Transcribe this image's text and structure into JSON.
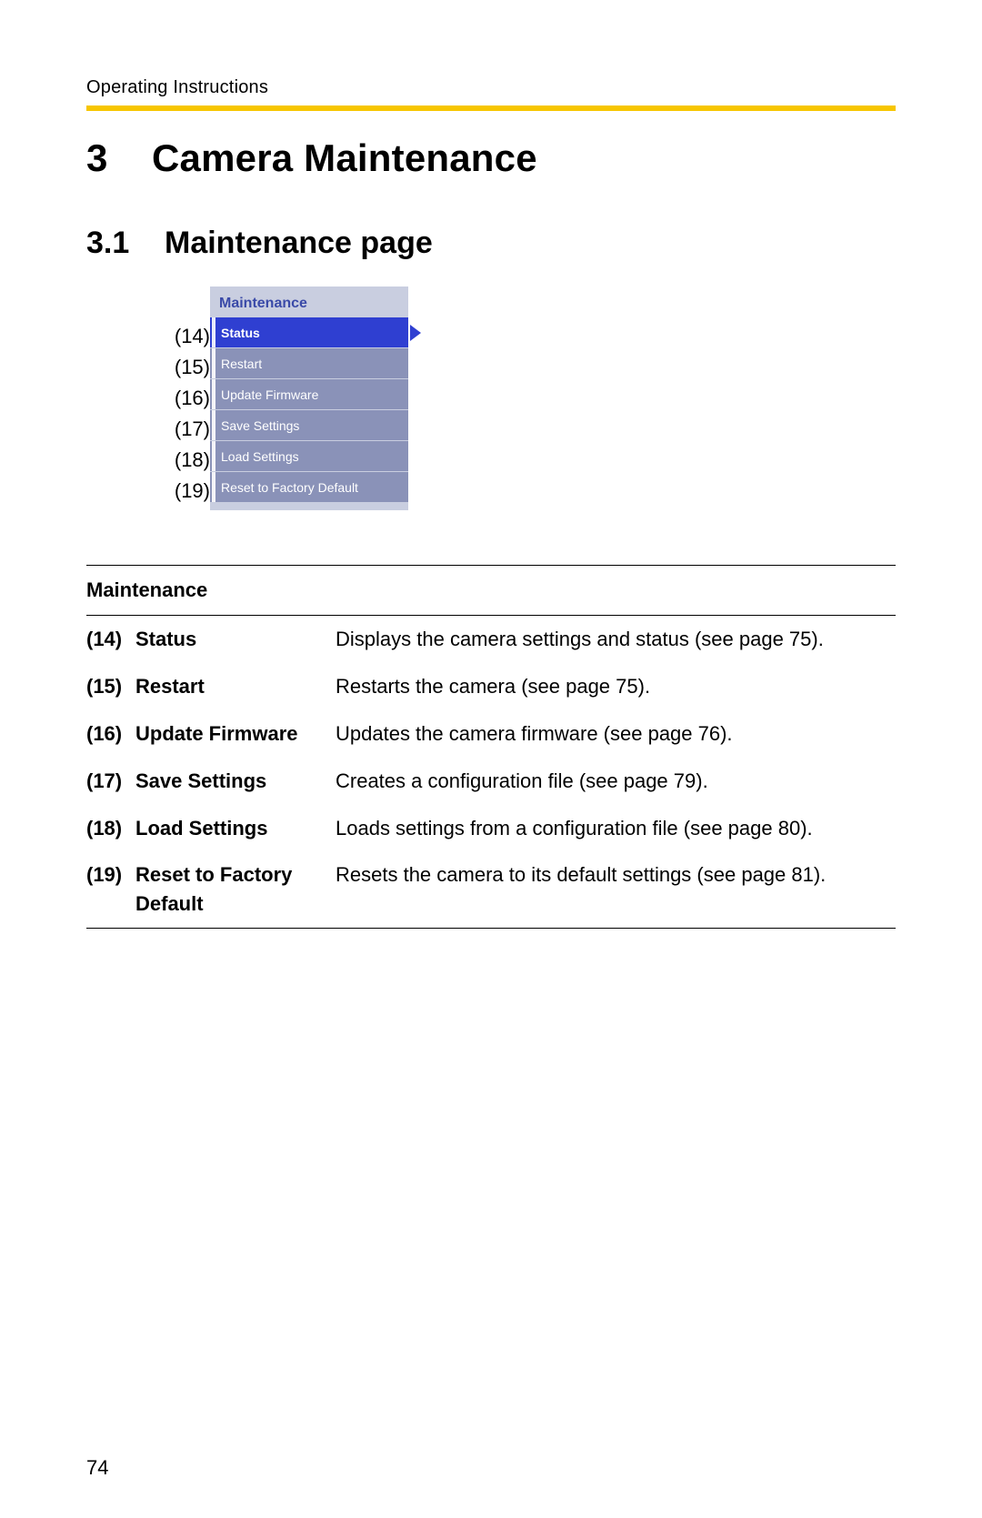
{
  "running_head": "Operating Instructions",
  "chapter": {
    "number": "3",
    "title": "Camera Maintenance"
  },
  "section": {
    "number": "3.1",
    "title": "Maintenance page"
  },
  "menu": {
    "heading": "Maintenance",
    "items": [
      {
        "callout": "(14)",
        "label": "Status",
        "active": true
      },
      {
        "callout": "(15)",
        "label": "Restart",
        "active": false
      },
      {
        "callout": "(16)",
        "label": "Update Firmware",
        "active": false
      },
      {
        "callout": "(17)",
        "label": "Save Settings",
        "active": false
      },
      {
        "callout": "(18)",
        "label": "Load Settings",
        "active": false
      },
      {
        "callout": "(19)",
        "label": "Reset to Factory Default",
        "active": false
      }
    ]
  },
  "table": {
    "heading": "Maintenance",
    "rows": [
      {
        "num": "(14)",
        "name": "Status",
        "desc": "Displays the camera settings and status (see page 75)."
      },
      {
        "num": "(15)",
        "name": "Restart",
        "desc": "Restarts the camera (see page 75)."
      },
      {
        "num": "(16)",
        "name": "Update Firmware",
        "desc": "Updates the camera firmware (see page 76)."
      },
      {
        "num": "(17)",
        "name": "Save Settings",
        "desc": "Creates a configuration file (see page 79)."
      },
      {
        "num": "(18)",
        "name": "Load Settings",
        "desc": "Loads settings from a configuration file (see page 80)."
      },
      {
        "num": "(19)",
        "name": "Reset to Factory Default",
        "desc": "Resets the camera to its default settings (see page 81)."
      }
    ]
  },
  "page_number": "74"
}
